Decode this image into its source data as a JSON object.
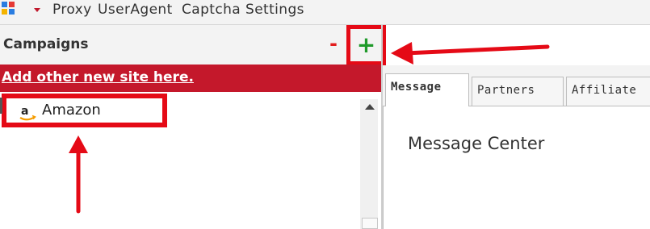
{
  "menubar": {
    "items": [
      "Proxy",
      "UserAgent",
      "Captcha",
      "Settings"
    ]
  },
  "left_panel": {
    "title": "Campaigns",
    "remove_label": "-",
    "add_label": "+",
    "banner_text": "Add other new site here.",
    "sites": [
      {
        "name": "Amazon",
        "icon": "amazon-icon"
      }
    ]
  },
  "right_panel": {
    "tabs": [
      "Message",
      "Partners",
      "Affiliate"
    ],
    "active_tab": "Message",
    "content_heading": "Message Center"
  },
  "colors": {
    "annotation_red": "#e50a16",
    "banner_red": "#c4182b",
    "add_green": "#1f9a2a"
  }
}
